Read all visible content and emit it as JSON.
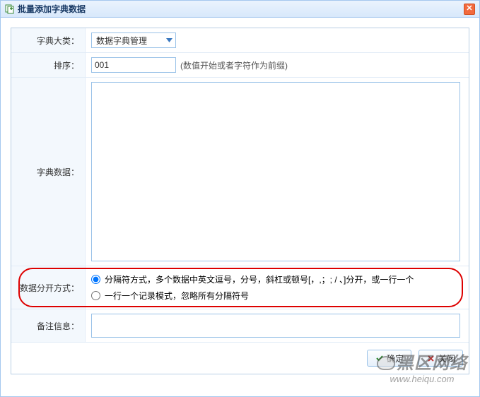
{
  "window": {
    "title": "批量添加字典数据"
  },
  "form": {
    "category": {
      "label": "字典大类：",
      "value": "数据字典管理"
    },
    "order": {
      "label": "排序：",
      "value": "001",
      "hint": "(数值开始或者字符作为前缀)"
    },
    "dict_data": {
      "label": "字典数据：",
      "value": ""
    },
    "split_mode": {
      "label": "数据分开方式：",
      "options": {
        "delimiter": "分隔符方式，多个数据中英文逗号，分号，斜杠或顿号[，,；; / 、]分开，或一行一个",
        "line": "一行一个记录模式，忽略所有分隔符号"
      }
    },
    "remark": {
      "label": "备注信息：",
      "value": ""
    }
  },
  "buttons": {
    "ok": "确定",
    "cancel": "关闭"
  },
  "watermark": {
    "text": "黑区网络",
    "url": "www.heiqu.com"
  }
}
